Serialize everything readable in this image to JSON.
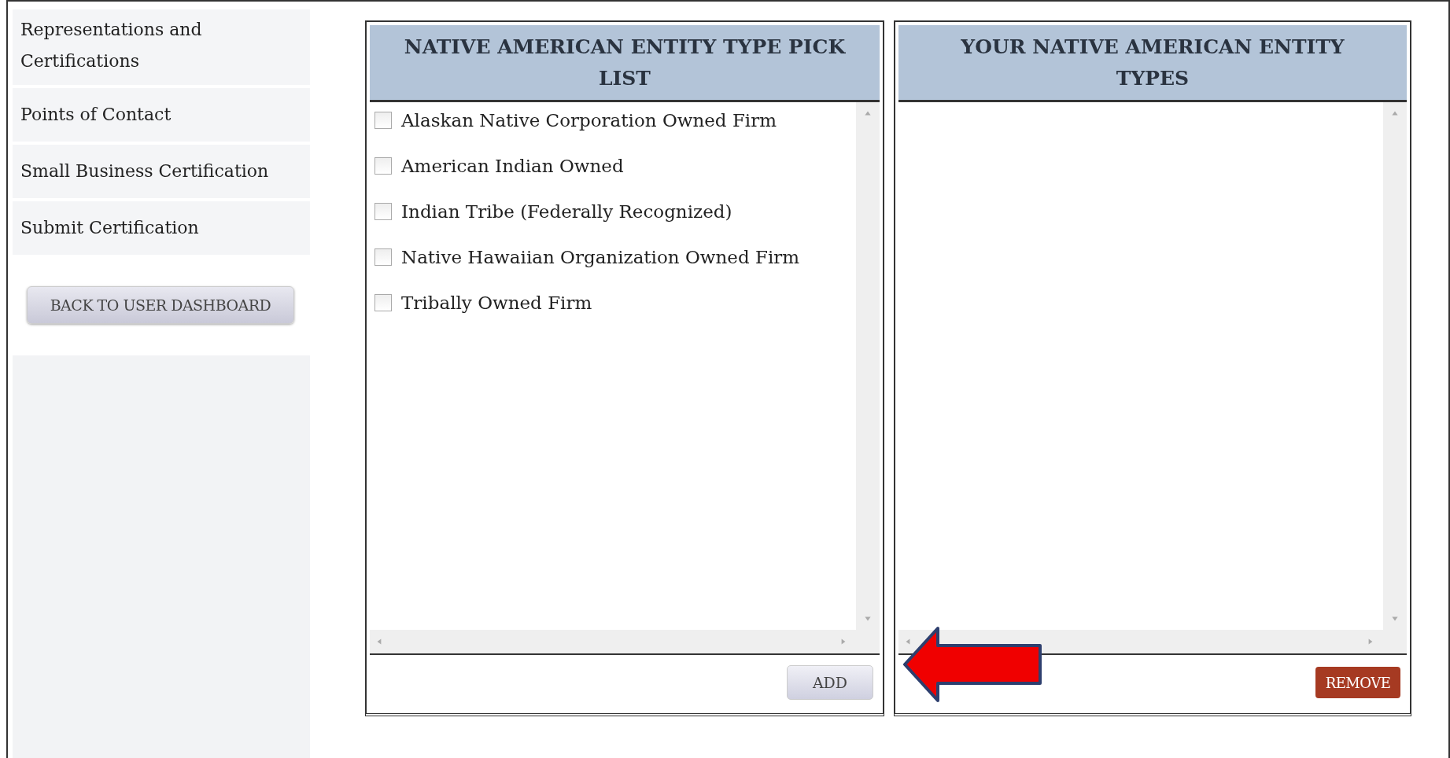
{
  "sidebar": {
    "items": [
      {
        "label": "Representations and Certifications"
      },
      {
        "label": "Points of Contact"
      },
      {
        "label": "Small Business Certification"
      },
      {
        "label": "Submit Certification"
      }
    ],
    "back_button": "BACK TO USER DASHBOARD"
  },
  "pick_list": {
    "title": "NATIVE AMERICAN ENTITY TYPE PICK LIST",
    "items": [
      {
        "label": "Alaskan Native Corporation Owned Firm",
        "checked": false
      },
      {
        "label": "American Indian Owned",
        "checked": false
      },
      {
        "label": "Indian Tribe (Federally Recognized)",
        "checked": false
      },
      {
        "label": "Native Hawaiian Organization Owned Firm",
        "checked": false
      },
      {
        "label": "Tribally Owned Firm",
        "checked": false
      }
    ],
    "button": "ADD"
  },
  "selected_list": {
    "title": "YOUR NATIVE AMERICAN ENTITY TYPES",
    "button": "REMOVE"
  }
}
